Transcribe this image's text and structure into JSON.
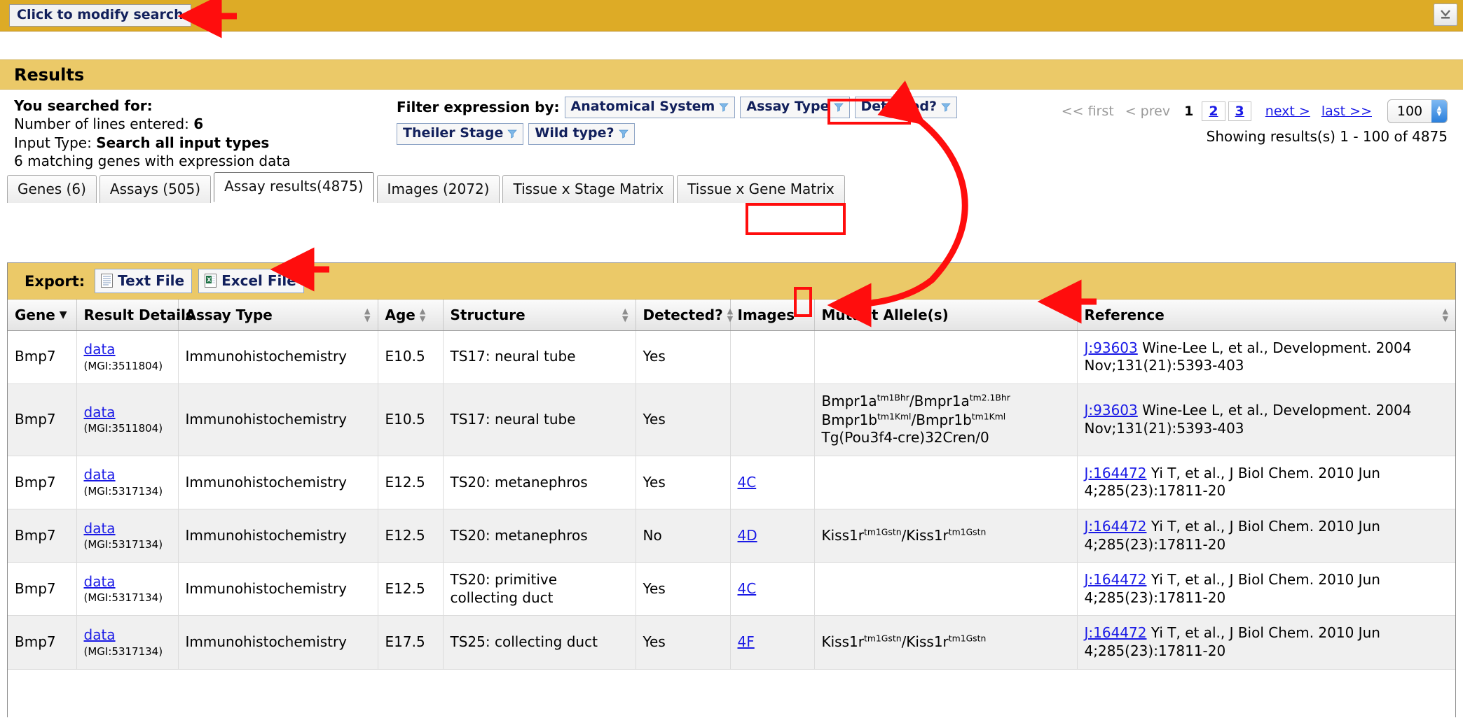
{
  "topbar": {
    "modify_search_label": "Click to modify search",
    "collapse_icon": "collapse-down-icon"
  },
  "results": {
    "title": "Results",
    "searched_for_label": "You searched for:",
    "lines_entered_label": "Number of lines entered:",
    "lines_entered_value": "6",
    "input_type_label": "Input Type:",
    "input_type_value": "Search all input types",
    "matching_text": "6 matching genes with expression data"
  },
  "filters": {
    "label": "Filter expression by:",
    "buttons": [
      {
        "label": "Anatomical System",
        "icon": "funnel-icon"
      },
      {
        "label": "Assay Type",
        "icon": "funnel-icon"
      },
      {
        "label": "Detected?",
        "icon": "funnel-icon"
      },
      {
        "label": "Theiler Stage",
        "icon": "funnel-icon"
      },
      {
        "label": "Wild type?",
        "icon": "funnel-icon"
      }
    ]
  },
  "pagination": {
    "first": "<< first",
    "prev": "< prev",
    "current_page": "1",
    "page_2": "2",
    "page_3": "3",
    "next": "next >",
    "last": "last >>",
    "page_size": "100",
    "showing": "Showing results(s) 1 - 100 of 4875"
  },
  "tabs": [
    {
      "label": "Genes (6)",
      "active": false
    },
    {
      "label": "Assays (505)",
      "active": false
    },
    {
      "label": "Assay results(4875)",
      "active": true
    },
    {
      "label": "Images (2072)",
      "active": false
    },
    {
      "label": "Tissue x Stage Matrix",
      "active": false
    },
    {
      "label": "Tissue x Gene Matrix",
      "active": false
    }
  ],
  "export": {
    "label": "Export:",
    "text_file": "Text File",
    "excel_file": "Excel File",
    "text_icon": "text-file-icon",
    "excel_icon": "excel-file-icon"
  },
  "table": {
    "columns": [
      {
        "label": "Gene",
        "sort": "desc-caret"
      },
      {
        "label": "Result Details",
        "sort": "none"
      },
      {
        "label": "Assay Type",
        "sort": "both"
      },
      {
        "label": "Age",
        "sort": "both"
      },
      {
        "label": "Structure",
        "sort": "both"
      },
      {
        "label": "Detected?",
        "sort": "both"
      },
      {
        "label": "Images",
        "sort": "none"
      },
      {
        "label": "Mutant Allele(s)",
        "sort": "none"
      },
      {
        "label": "Reference",
        "sort": "both"
      }
    ],
    "rows": [
      {
        "gene": "Bmp7",
        "result_details_link": "data",
        "result_details_id": "(MGI:3511804)",
        "assay_type": "Immunohistochemistry",
        "age": "E10.5",
        "structure": "TS17: neural tube",
        "detected": "Yes",
        "images": "",
        "mutant_alleles": "",
        "mutant_alleles_html": "",
        "reference_link": "J:93603",
        "reference_text": "Wine-Lee L, et al., Development. 2004 Nov;131(21):5393-403"
      },
      {
        "gene": "Bmp7",
        "result_details_link": "data",
        "result_details_id": "(MGI:3511804)",
        "assay_type": "Immunohistochemistry",
        "age": "E10.5",
        "structure": "TS17: neural tube",
        "detected": "Yes",
        "images": "",
        "mutant_alleles": "Bmpr1a(tm1Bhr)/Bmpr1a(tm2.1Bhr) Bmpr1b(tm1Kml)/Bmpr1b(tm1Kml) Tg(Pou3f4-cre)32Cren/0",
        "mutant_alleles_html": "Bmpr1a<sup>tm1Bhr</sup>/Bmpr1a<sup>tm2.1Bhr</sup><br>Bmpr1b<sup>tm1Kml</sup>/Bmpr1b<sup>tm1Kml</sup><br>Tg(Pou3f4-cre)32Cren/0",
        "reference_link": "J:93603",
        "reference_text": "Wine-Lee L, et al., Development. 2004 Nov;131(21):5393-403"
      },
      {
        "gene": "Bmp7",
        "result_details_link": "data",
        "result_details_id": "(MGI:5317134)",
        "assay_type": "Immunohistochemistry",
        "age": "E12.5",
        "structure": "TS20: metanephros",
        "detected": "Yes",
        "images": "4C",
        "mutant_alleles": "",
        "mutant_alleles_html": "",
        "reference_link": "J:164472",
        "reference_text": "Yi T, et al., J Biol Chem. 2010 Jun 4;285(23):17811-20"
      },
      {
        "gene": "Bmp7",
        "result_details_link": "data",
        "result_details_id": "(MGI:5317134)",
        "assay_type": "Immunohistochemistry",
        "age": "E12.5",
        "structure": "TS20: metanephros",
        "detected": "No",
        "images": "4D",
        "mutant_alleles": "Kiss1r(tm1Gstn)/Kiss1r(tm1Gstn)",
        "mutant_alleles_html": "Kiss1r<sup>tm1Gstn</sup>/Kiss1r<sup>tm1Gstn</sup>",
        "reference_link": "J:164472",
        "reference_text": "Yi T, et al., J Biol Chem. 2010 Jun 4;285(23):17811-20"
      },
      {
        "gene": "Bmp7",
        "result_details_link": "data",
        "result_details_id": "(MGI:5317134)",
        "assay_type": "Immunohistochemistry",
        "age": "E12.5",
        "structure": "TS20: primitive collecting duct",
        "detected": "Yes",
        "images": "4C",
        "mutant_alleles": "",
        "mutant_alleles_html": "",
        "reference_link": "J:164472",
        "reference_text": "Yi T, et al., J Biol Chem. 2010 Jun 4;285(23):17811-20"
      },
      {
        "gene": "Bmp7",
        "result_details_link": "data",
        "result_details_id": "(MGI:5317134)",
        "assay_type": "Immunohistochemistry",
        "age": "E17.5",
        "structure": "TS25: collecting duct",
        "detected": "Yes",
        "images": "4F",
        "mutant_alleles": "Kiss1r(tm1Gstn)/Kiss1r(tm1Gstn)",
        "mutant_alleles_html": "Kiss1r<sup>tm1Gstn</sup>/Kiss1r<sup>tm1Gstn</sup>",
        "reference_link": "J:164472",
        "reference_text": "Yi T, et al., J Biol Chem. 2010 Jun 4;285(23):17811-20"
      }
    ]
  },
  "annotations": {
    "color": "#ff0d0d",
    "highlight_boxes": [
      "detected-filter-button",
      "tissue-x-gene-matrix-tab",
      "detected-column-sort-arrow"
    ],
    "arrows": [
      "arrow-to-modify-search",
      "arrow-to-excel-file",
      "arrow-to-mutant-allele",
      "curved-arrow-detected-filter-to-detected-sort"
    ]
  }
}
